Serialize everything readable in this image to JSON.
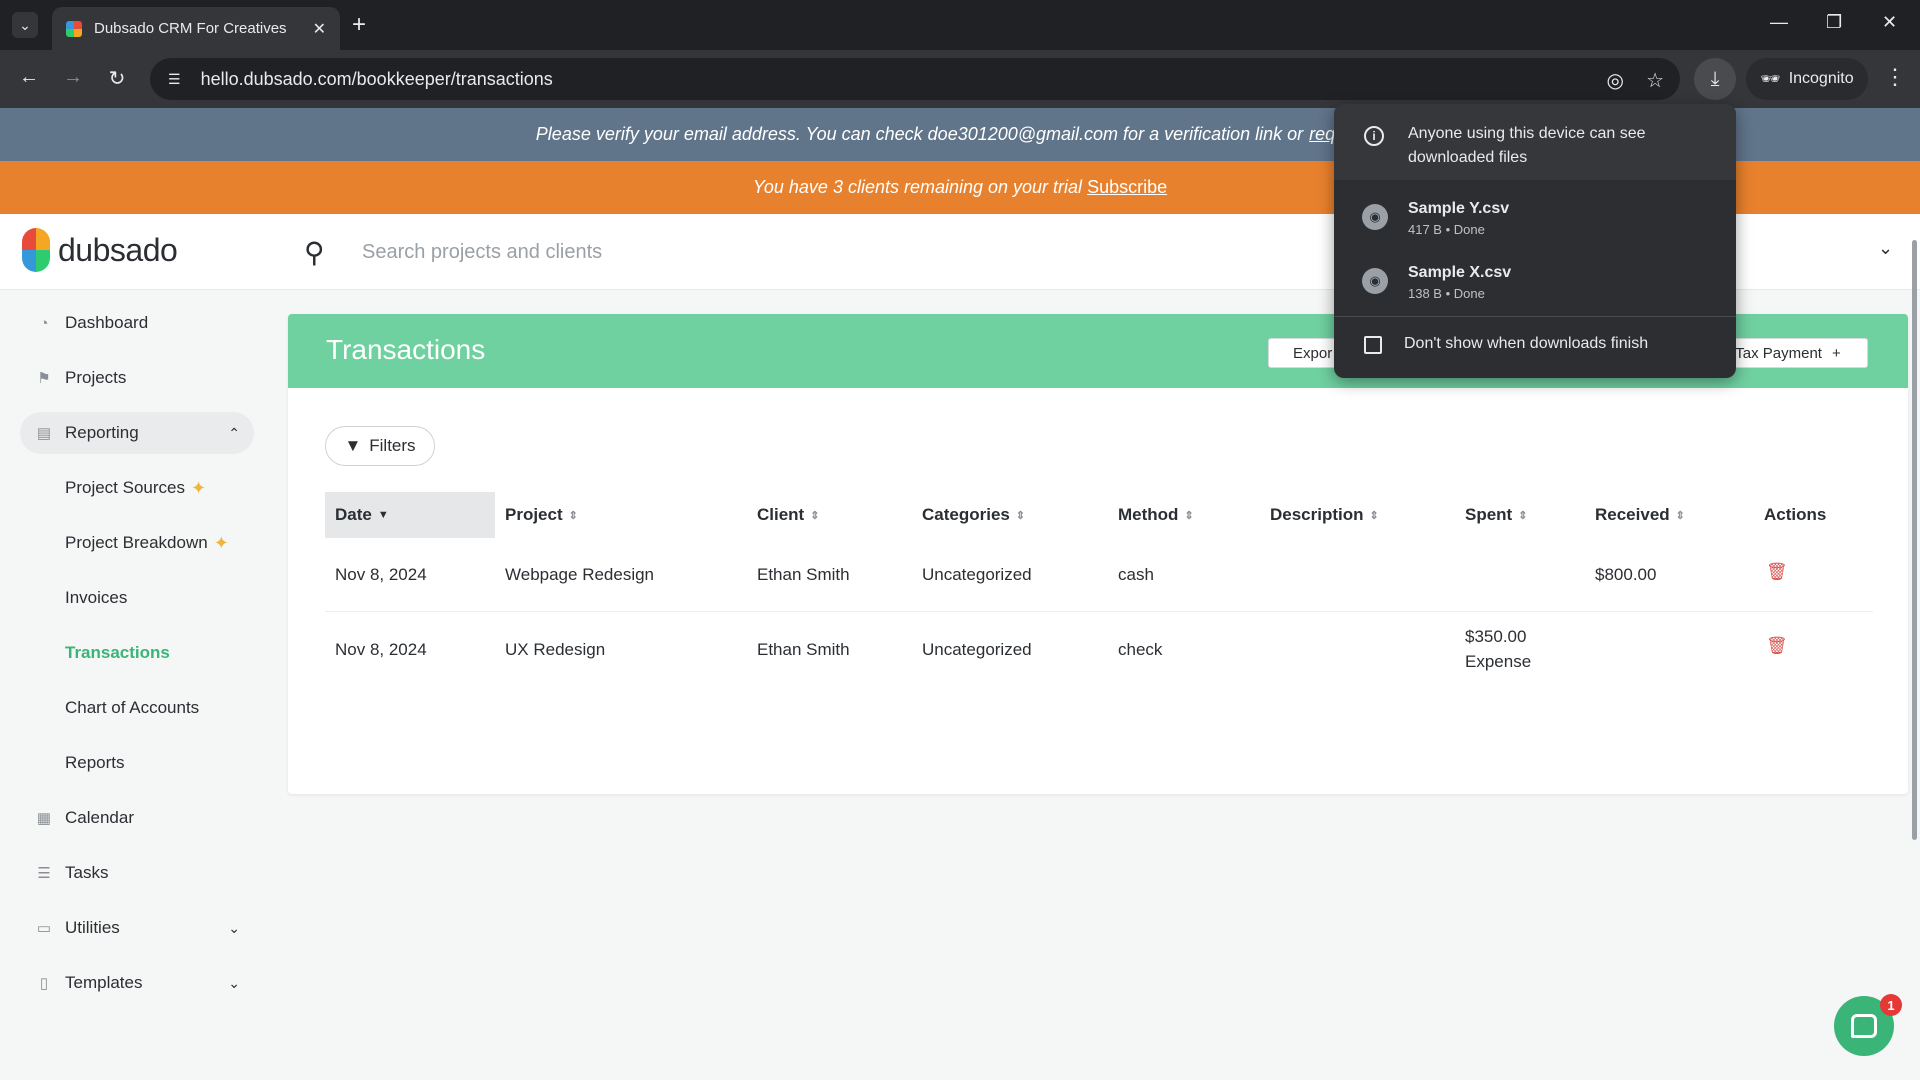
{
  "browser": {
    "tab_title": "Dubsado CRM For Creatives",
    "url": "hello.dubsado.com/bookkeeper/transactions",
    "incognito_label": "Incognito"
  },
  "banners": {
    "verify_text": "Please verify your email address. You can check doe301200@gmail.com for a verification link or",
    "verify_link": "request a",
    "trial_text": "You have 3 clients remaining on your trial",
    "trial_link": "Subscribe"
  },
  "header": {
    "logo_text": "dubsado",
    "search_placeholder": "Search projects and clients"
  },
  "sidebar": {
    "items": [
      {
        "label": "Dashboard",
        "icon": "dashboard-icon"
      },
      {
        "label": "Projects",
        "icon": "projects-icon"
      },
      {
        "label": "Reporting",
        "icon": "reporting-icon"
      },
      {
        "label": "Calendar",
        "icon": "calendar-icon"
      },
      {
        "label": "Tasks",
        "icon": "tasks-icon"
      },
      {
        "label": "Utilities",
        "icon": "utilities-icon"
      },
      {
        "label": "Templates",
        "icon": "templates-icon"
      }
    ],
    "reporting_sub": [
      "Project Sources",
      "Project Breakdown",
      "Invoices",
      "Transactions",
      "Chart of Accounts",
      "Reports"
    ]
  },
  "main": {
    "title": "Transactions",
    "export_label": "Expor",
    "tax_label": "Tax Payment",
    "filters_label": "Filters",
    "columns": [
      "Date",
      "Project",
      "Client",
      "Categories",
      "Method",
      "Description",
      "Spent",
      "Received",
      "Actions"
    ],
    "rows": [
      {
        "date": "Nov 8, 2024",
        "project": "Webpage Redesign",
        "client": "Ethan Smith",
        "category": "Uncategorized",
        "method": "cash",
        "description": "",
        "spent": "",
        "spent_type": "",
        "received": "$800.00"
      },
      {
        "date": "Nov 8, 2024",
        "project": "UX Redesign",
        "client": "Ethan Smith",
        "category": "Uncategorized",
        "method": "check",
        "description": "",
        "spent": "$350.00",
        "spent_type": "Expense",
        "received": ""
      }
    ]
  },
  "downloads": {
    "warning": "Anyone using this device can see downloaded files",
    "files": [
      {
        "name": "Sample Y.csv",
        "meta": "417 B • Done"
      },
      {
        "name": "Sample X.csv",
        "meta": "138 B • Done"
      }
    ],
    "checkbox_label": "Don't show when downloads finish"
  },
  "chat": {
    "badge": "1"
  },
  "colors": {
    "accent": "#3ab577",
    "header_green": "#6fd0a0",
    "trial_orange": "#e8812d",
    "verify_slate": "#60748a"
  }
}
